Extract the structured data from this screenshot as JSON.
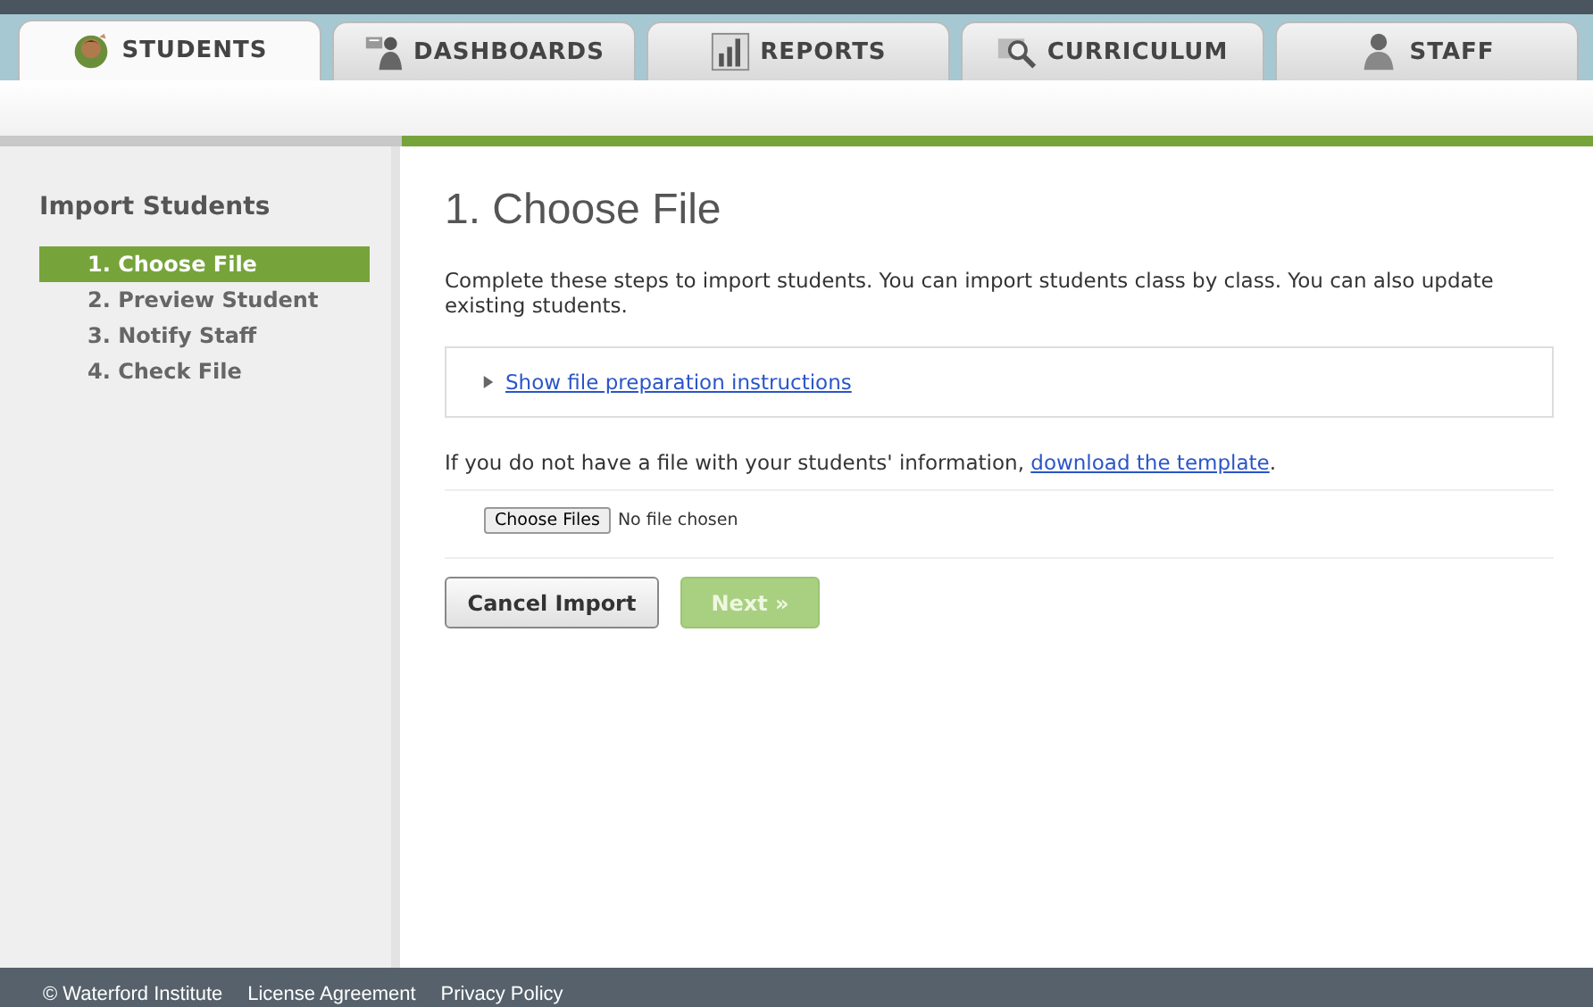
{
  "tabs": [
    {
      "label": "STUDENTS",
      "kind": "student",
      "selected": true
    },
    {
      "label": "DASHBOARDS",
      "kind": "presenter",
      "selected": false
    },
    {
      "label": "REPORTS",
      "kind": "chart",
      "selected": false
    },
    {
      "label": "CURRICULUM",
      "kind": "magnifier",
      "selected": false
    },
    {
      "label": "STAFF",
      "kind": "staff",
      "selected": false
    }
  ],
  "sidebar": {
    "title": "Import Students",
    "steps": [
      {
        "label": "1. Choose File",
        "selected": true
      },
      {
        "label": "2. Preview Student",
        "selected": false
      },
      {
        "label": "3. Notify Staff",
        "selected": false
      },
      {
        "label": "4. Check File",
        "selected": false
      }
    ]
  },
  "main": {
    "heading": "1. Choose File",
    "intro": "Complete these steps to import students. You can import students class by class. You can also update existing students.",
    "instructions_toggle": {
      "label": "Show file preparation instructions",
      "expanded": false
    },
    "template_text": "If you do not have a file with your students' information,",
    "template_link": "download the template",
    "template_end": ".",
    "file_button": "Choose Files",
    "file_status": "No file chosen",
    "buttons": [
      {
        "label": "Cancel Import",
        "kind": "secondary",
        "disabled": false
      },
      {
        "label": "Next »",
        "kind": "primary",
        "disabled": true
      }
    ]
  },
  "footer": [
    "© Waterford Institute",
    "License Agreement",
    "Privacy Policy"
  ]
}
